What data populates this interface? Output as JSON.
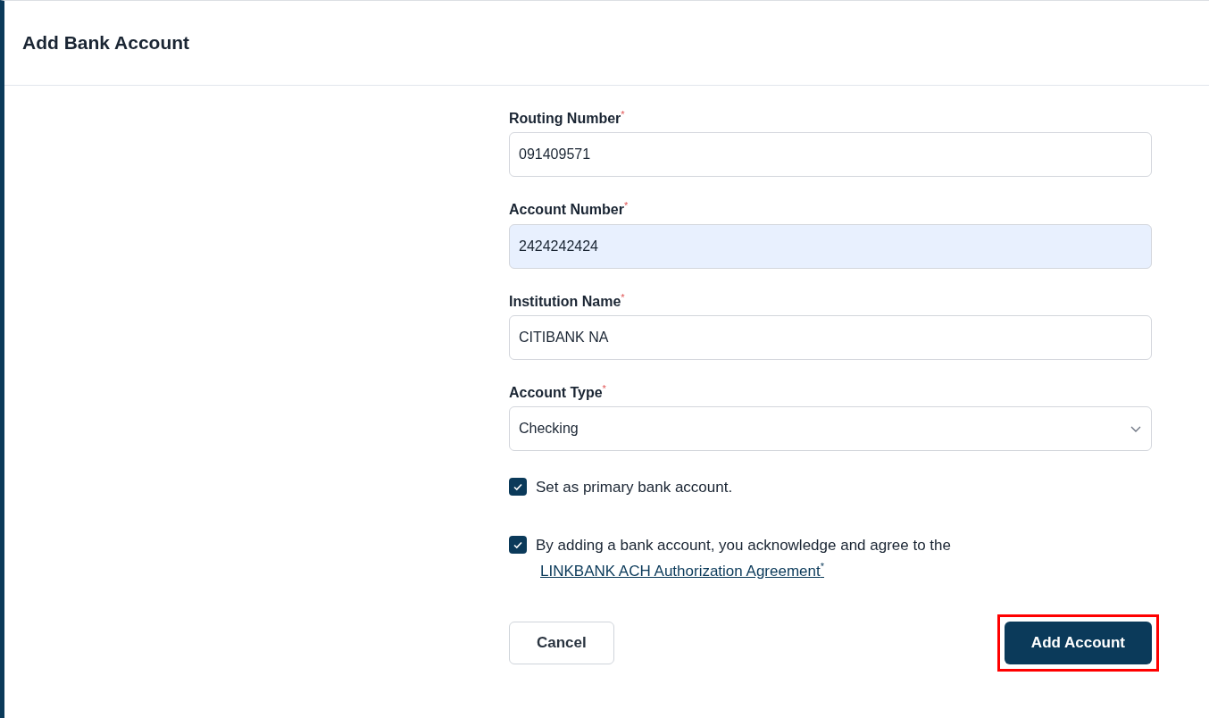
{
  "dialog": {
    "title": "Add Bank Account"
  },
  "fields": [
    {
      "kind": "text",
      "label": "Routing Number",
      "required_mark": "*",
      "value": "091409571",
      "autofilled": false
    },
    {
      "kind": "text",
      "label": "Account Number",
      "required_mark": "*",
      "value": "2424242424",
      "autofilled": true
    },
    {
      "kind": "text",
      "label": "Institution Name",
      "required_mark": "*",
      "value": "CITIBANK NA",
      "autofilled": false
    },
    {
      "kind": "select",
      "label": "Account Type",
      "required_mark": "*",
      "value": "Checking",
      "autofilled": false
    }
  ],
  "checkboxes": [
    {
      "label": "Set as primary bank account.",
      "checked": true
    },
    {
      "label": "By adding a bank account, you acknowledge and agree to the",
      "checked": true,
      "link": "LINKBANK ACH Authorization Agreement",
      "link_mark": "*"
    }
  ],
  "buttons": [
    {
      "kind": "secondary",
      "label": "Cancel",
      "highlighted": false
    },
    {
      "kind": "primary",
      "label": "Add Account",
      "highlighted": true
    }
  ]
}
